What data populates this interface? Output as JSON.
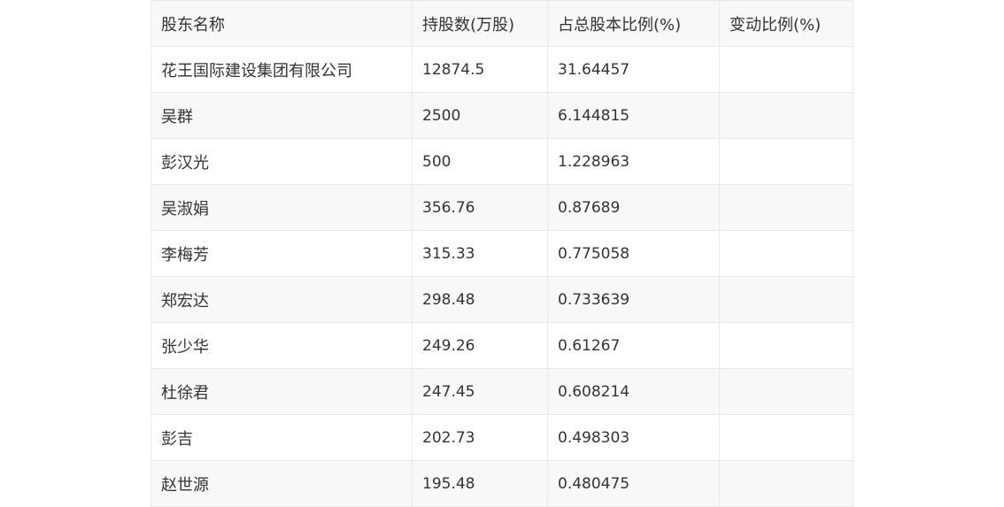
{
  "table": {
    "headers": [
      "股东名称",
      "持股数(万股)",
      "占总股本比例(%)",
      "变动比例(%)"
    ],
    "rows": [
      {
        "name": "花王国际建设集团有限公司",
        "shares": "12874.5",
        "ratio": "31.64457",
        "change": ""
      },
      {
        "name": "吴群",
        "shares": "2500",
        "ratio": "6.144815",
        "change": ""
      },
      {
        "name": "彭汉光",
        "shares": "500",
        "ratio": "1.228963",
        "change": ""
      },
      {
        "name": "吴淑娟",
        "shares": "356.76",
        "ratio": "0.87689",
        "change": ""
      },
      {
        "name": "李梅芳",
        "shares": "315.33",
        "ratio": "0.775058",
        "change": ""
      },
      {
        "name": "郑宏达",
        "shares": "298.48",
        "ratio": "0.733639",
        "change": ""
      },
      {
        "name": "张少华",
        "shares": "249.26",
        "ratio": "0.61267",
        "change": ""
      },
      {
        "name": "杜徐君",
        "shares": "247.45",
        "ratio": "0.608214",
        "change": ""
      },
      {
        "name": "彭吉",
        "shares": "202.73",
        "ratio": "0.498303",
        "change": ""
      },
      {
        "name": "赵世源",
        "shares": "195.48",
        "ratio": "0.480475",
        "change": ""
      }
    ]
  }
}
